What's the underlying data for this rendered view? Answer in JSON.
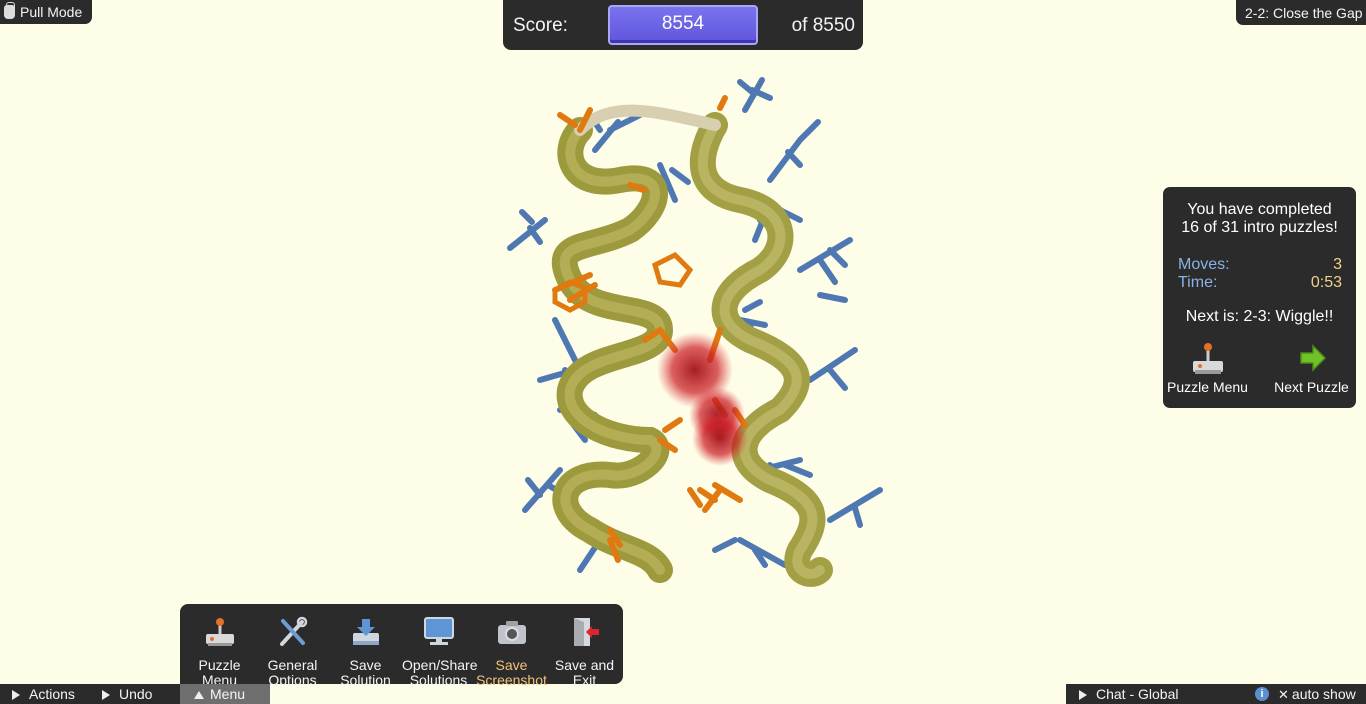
{
  "top_left": {
    "mode_label": "Pull Mode",
    "mode_icon": "hand-icon"
  },
  "score": {
    "label": "Score:",
    "value": "8554",
    "target": "of 8550"
  },
  "puzzle": {
    "title": "2-2: Close the Gap"
  },
  "completion": {
    "message_line1": "You have completed",
    "message_line2": "16 of 31 intro puzzles!",
    "moves_label": "Moves:",
    "moves_value": "3",
    "time_label": "Time:",
    "time_value": "0:53",
    "next_label": "Next is: 2-3: Wiggle!!",
    "puzzle_menu_label": "Puzzle Menu",
    "next_puzzle_label": "Next Puzzle"
  },
  "menu": {
    "items": [
      {
        "line1": "Puzzle",
        "line2": "Menu",
        "icon": "joystick-icon"
      },
      {
        "line1": "General",
        "line2": "Options",
        "icon": "tools-icon"
      },
      {
        "line1": "Save",
        "line2": "Solution",
        "icon": "save-tray-icon"
      },
      {
        "line1": "Open/Share",
        "line2": "Solutions",
        "icon": "monitor-icon"
      },
      {
        "line1": "Save",
        "line2": "Screenshot",
        "icon": "camera-icon"
      },
      {
        "line1": "Save and",
        "line2": "Exit",
        "icon": "exit-door-icon"
      }
    ]
  },
  "bottom_bar": {
    "actions_label": "Actions",
    "undo_label": "Undo",
    "menu_label": "Menu",
    "chat_label": "Chat - Global",
    "auto_show_label": "auto show"
  },
  "colors": {
    "background": "#fefde8",
    "panel": "#2b2b2b",
    "score_box": "#6d66e6",
    "highlight_text": "#f2c27c",
    "stat_label": "#89b2e4",
    "stat_value": "#f2d08a",
    "helix": "#a8a64a",
    "sidechain_hydrophobic": "#e07a10",
    "sidechain_polar": "#4f78b3",
    "clash": "#cc1a22"
  }
}
